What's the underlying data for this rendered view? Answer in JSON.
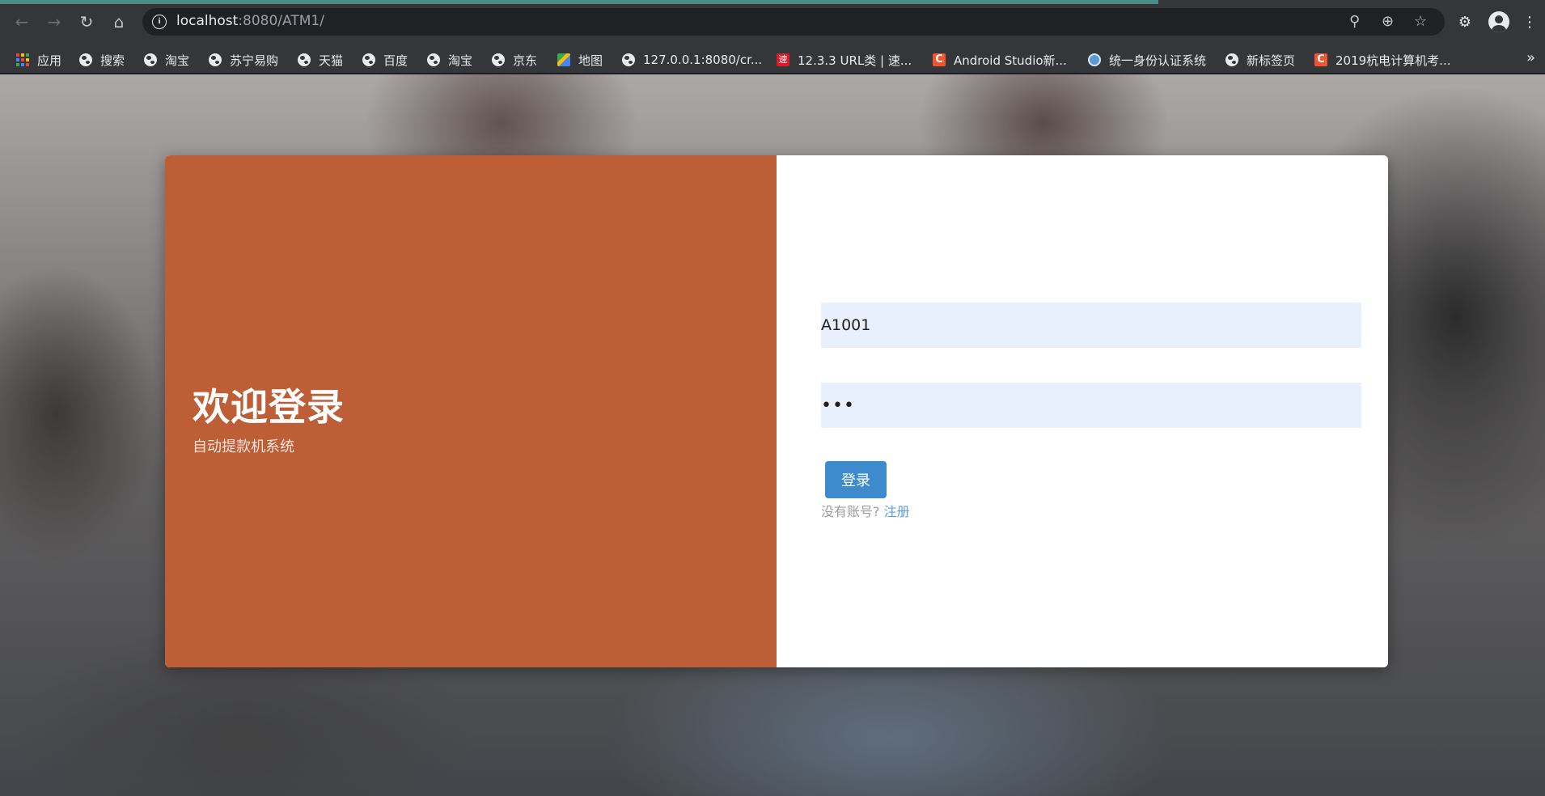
{
  "browser": {
    "url_host": "localhost",
    "url_path": ":8080/ATM1/",
    "nav": {
      "back": "back-icon",
      "forward": "forward-icon",
      "reload": "reload-icon",
      "home": "home-icon"
    },
    "right_icons": [
      "key-icon",
      "zoom-icon",
      "star-icon",
      "extensions-icon",
      "profile-icon",
      "menu-icon"
    ],
    "accent_color": "#4a8f83"
  },
  "bookmarks": [
    {
      "label": "应用",
      "icon": "apps-icon"
    },
    {
      "label": "搜索",
      "icon": "globe-icon"
    },
    {
      "label": "淘宝",
      "icon": "globe-icon"
    },
    {
      "label": "苏宁易购",
      "icon": "globe-icon"
    },
    {
      "label": "天猫",
      "icon": "globe-icon"
    },
    {
      "label": "百度",
      "icon": "globe-icon"
    },
    {
      "label": "淘宝",
      "icon": "globe-icon"
    },
    {
      "label": "京东",
      "icon": "globe-icon"
    },
    {
      "label": "地图",
      "icon": "maps-icon"
    },
    {
      "label": "127.0.0.1:8080/cr...",
      "icon": "globe-icon"
    },
    {
      "label": "12.3.3 URL类 | 速...",
      "icon": "speed-icon"
    },
    {
      "label": "Android Studio新...",
      "icon": "csdn-icon"
    },
    {
      "label": "统一身份认证系统",
      "icon": "id-auth-icon"
    },
    {
      "label": "新标签页",
      "icon": "globe-icon"
    },
    {
      "label": "2019杭电计算机考...",
      "icon": "csdn-icon"
    }
  ],
  "bookmarks_more": "»",
  "login": {
    "title": "欢迎登录",
    "subtitle": "自动提款机系统",
    "username_value": "A1001",
    "password_value": "•••",
    "login_button": "登录",
    "no_account_text": "没有账号?",
    "register_link": "注册",
    "panel_color": "#bd5e37",
    "button_color": "#3d8bcd"
  }
}
